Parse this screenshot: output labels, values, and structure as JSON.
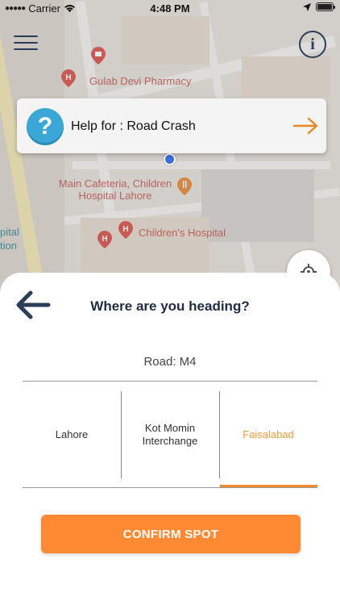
{
  "status_bar": {
    "carrier": "Carrier",
    "time": "4:48 PM"
  },
  "map": {
    "labels": {
      "pharmacy": "Gulab Devi Pharmacy",
      "cafeteria_line1": "Main Cafeteria, Children",
      "cafeteria_line2": "Hospital Lahore",
      "hospital": "Children's Hospital",
      "left_edge_1": "pital",
      "left_edge_2": "tion"
    }
  },
  "help_card": {
    "text": "Help for : Road Crash"
  },
  "sheet": {
    "title": "Where are you heading?",
    "road_label": "Road: M4",
    "options": [
      {
        "label": "Lahore",
        "selected": false
      },
      {
        "label": "Kot Momin Interchange",
        "selected": false
      },
      {
        "label": "Faisalabad",
        "selected": true
      }
    ],
    "confirm_label": "CONFIRM SPOT"
  },
  "colors": {
    "accent_orange": "#ff8a33",
    "navy": "#2c3e57",
    "help_blue": "#3aa7d6",
    "location_blue": "#3a6ed9"
  }
}
